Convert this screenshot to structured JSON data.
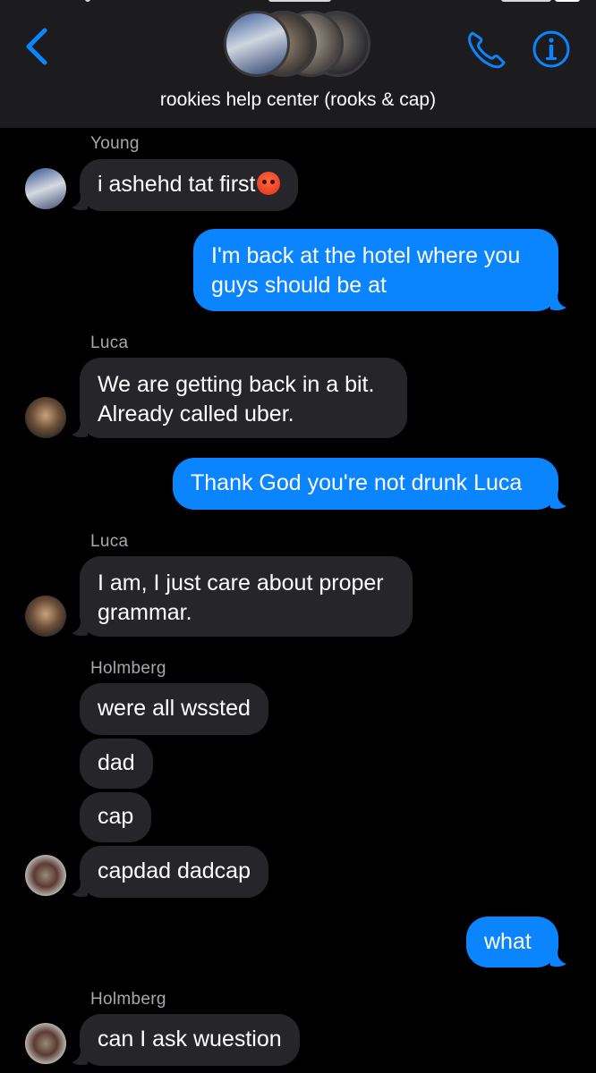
{
  "header": {
    "group_name": "rookies help center (rooks & cap)"
  },
  "colors": {
    "background": "#000000",
    "header_bg": "#1c1c1e",
    "incoming_bubble": "#26252a",
    "outgoing_bubble": "#0a84ff",
    "accent": "#0a84ff",
    "sender_label": "#a8a8ad"
  },
  "icons": {
    "back": "chevron-left-icon",
    "call": "phone-icon",
    "info": "info-icon",
    "emoji": "angry-face-emoji"
  },
  "messages": [
    {
      "sender": "Young",
      "text": "i ashehd tat first",
      "direction": "incoming"
    },
    {
      "text_lines": [
        "I'm back at the hotel where you",
        "guys should be at"
      ],
      "direction": "outgoing"
    },
    {
      "sender": "Luca",
      "text_lines": [
        "We are getting back in a bit.",
        "Already called uber."
      ],
      "direction": "incoming"
    },
    {
      "text": "Thank God you're not drunk Luca",
      "direction": "outgoing"
    },
    {
      "sender": "Luca",
      "text_lines": [
        "I am, I just care about proper",
        "grammar."
      ],
      "direction": "incoming"
    },
    {
      "sender": "Holmberg",
      "text": "were all wssted",
      "direction": "incoming"
    },
    {
      "text": "dad",
      "direction": "incoming"
    },
    {
      "text": "cap",
      "direction": "incoming"
    },
    {
      "text": "capdad dadcap",
      "direction": "incoming"
    },
    {
      "text": "what",
      "direction": "outgoing"
    },
    {
      "sender": "Holmberg",
      "text": "can I ask wuestion",
      "direction": "incoming"
    }
  ]
}
